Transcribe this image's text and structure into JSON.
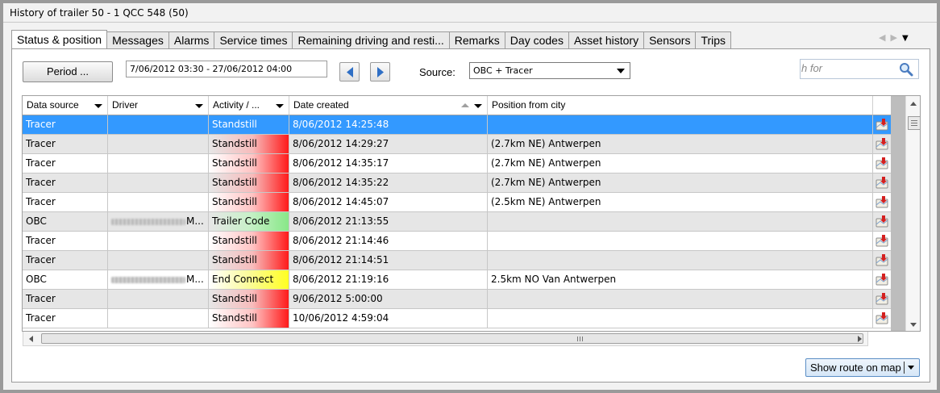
{
  "window": {
    "title": "History of trailer 50 - 1 QCC 548 (50)"
  },
  "tabs": [
    {
      "label": "Status & position",
      "active": true
    },
    {
      "label": "Messages"
    },
    {
      "label": "Alarms"
    },
    {
      "label": "Service times"
    },
    {
      "label": "Remaining driving and resti..."
    },
    {
      "label": "Remarks"
    },
    {
      "label": "Day codes"
    },
    {
      "label": "Asset history"
    },
    {
      "label": "Sensors"
    },
    {
      "label": "Trips"
    }
  ],
  "toolbar": {
    "period_label": "Period ...",
    "date_range": "7/06/2012 03:30 - 27/06/2012 04:00",
    "source_label": "Source:",
    "source_value": "OBC + Tracer",
    "search_text": "h for"
  },
  "grid": {
    "columns": [
      "Data source",
      "Driver",
      "Activity / ...",
      "Date created",
      "Position from city"
    ],
    "rows": [
      {
        "source": "Tracer",
        "driver": "",
        "driver_blurred": false,
        "driver_suffix": "",
        "activity": "Standstill",
        "activity_color": "red",
        "date": "8/06/2012 14:25:48",
        "position": "",
        "selected": true
      },
      {
        "source": "Tracer",
        "driver": "",
        "driver_blurred": false,
        "driver_suffix": "",
        "activity": "Standstill",
        "activity_color": "red",
        "date": "8/06/2012 14:29:27",
        "position": "(2.7km NE) Antwerpen"
      },
      {
        "source": "Tracer",
        "driver": "",
        "driver_blurred": false,
        "driver_suffix": "",
        "activity": "Standstill",
        "activity_color": "red",
        "date": "8/06/2012 14:35:17",
        "position": "(2.7km NE) Antwerpen"
      },
      {
        "source": "Tracer",
        "driver": "",
        "driver_blurred": false,
        "driver_suffix": "",
        "activity": "Standstill",
        "activity_color": "red",
        "date": "8/06/2012 14:35:22",
        "position": "(2.7km NE) Antwerpen"
      },
      {
        "source": "Tracer",
        "driver": "",
        "driver_blurred": false,
        "driver_suffix": "",
        "activity": "Standstill",
        "activity_color": "red",
        "date": "8/06/2012 14:45:07",
        "position": "(2.5km NE) Antwerpen"
      },
      {
        "source": "OBC",
        "driver": "",
        "driver_blurred": true,
        "driver_suffix": "M...",
        "activity": "Trailer Code",
        "activity_color": "green",
        "date": "8/06/2012 21:13:55",
        "position": ""
      },
      {
        "source": "Tracer",
        "driver": "",
        "driver_blurred": false,
        "driver_suffix": "",
        "activity": "Standstill",
        "activity_color": "red",
        "date": "8/06/2012 21:14:46",
        "position": ""
      },
      {
        "source": "Tracer",
        "driver": "",
        "driver_blurred": false,
        "driver_suffix": "",
        "activity": "Standstill",
        "activity_color": "red",
        "date": "8/06/2012 21:14:51",
        "position": ""
      },
      {
        "source": "OBC",
        "driver": "",
        "driver_blurred": true,
        "driver_suffix": "M...",
        "activity": "End Connect",
        "activity_color": "yellow",
        "date": "8/06/2012 21:19:16",
        "position": "2.5km NO Van Antwerpen"
      },
      {
        "source": "Tracer",
        "driver": "",
        "driver_blurred": false,
        "driver_suffix": "",
        "activity": "Standstill",
        "activity_color": "red",
        "date": "9/06/2012 5:00:00",
        "position": ""
      },
      {
        "source": "Tracer",
        "driver": "",
        "driver_blurred": false,
        "driver_suffix": "",
        "activity": "Standstill",
        "activity_color": "red",
        "date": "10/06/2012 4:59:04",
        "position": ""
      }
    ],
    "row_icon": "map-pin-icon",
    "sorted_column": "Date created"
  },
  "footer": {
    "route_button_label": "Show route on map"
  },
  "colors": {
    "selection": "#3399ff",
    "activity_red": "#ff1a1a",
    "activity_green": "#88e888",
    "activity_yellow": "#ffff22",
    "route_button_border": "#5b8ec5"
  }
}
